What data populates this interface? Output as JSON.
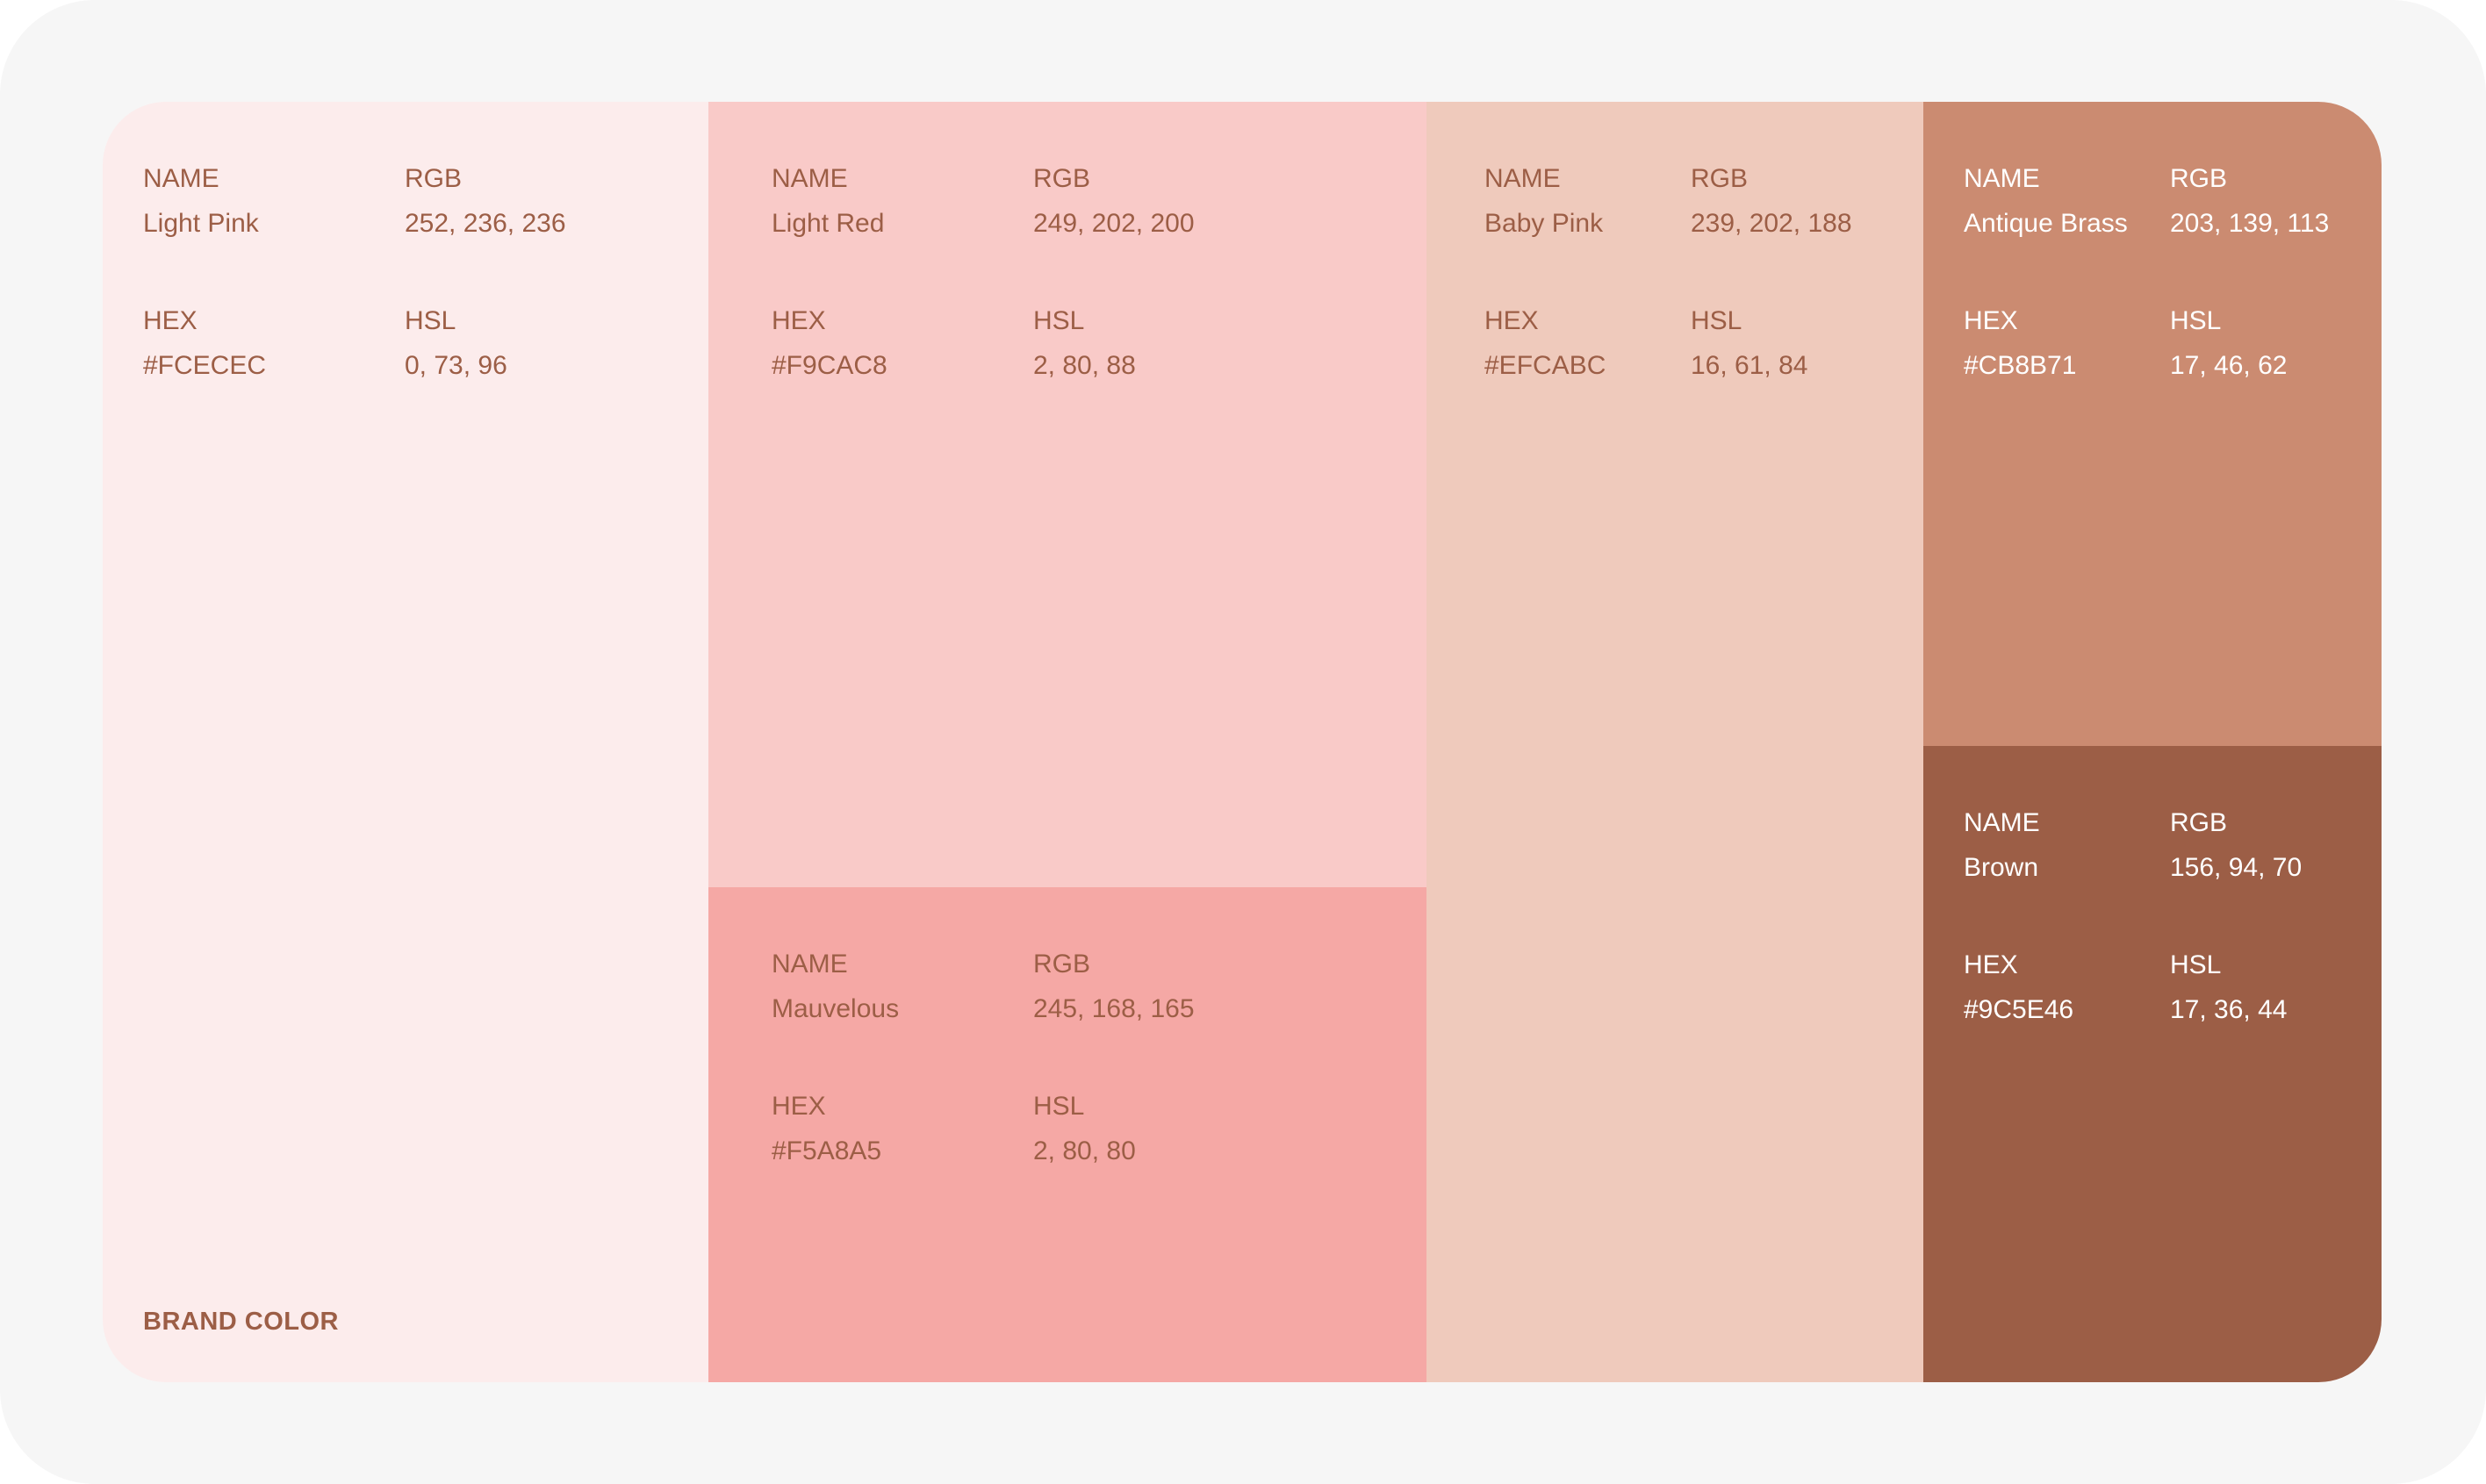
{
  "brand_label": "BRAND COLOR",
  "label_text_color": "#9C5E46",
  "swatches": [
    {
      "name": "Light Pink",
      "rgb": "252, 236, 236",
      "hex": "#FCECEC",
      "hsl": "0, 73, 96",
      "fill": "#FCECEC",
      "text_color": "#9C5E46",
      "labels": {
        "name": "NAME",
        "rgb": "RGB",
        "hex": "HEX",
        "hsl": "HSL"
      }
    },
    {
      "name": "Light Red",
      "rgb": "249, 202, 200",
      "hex": "#F9CAC8",
      "hsl": "2, 80, 88",
      "fill": "#F9CAC8",
      "text_color": "#9C5E46",
      "labels": {
        "name": "NAME",
        "rgb": "RGB",
        "hex": "HEX",
        "hsl": "HSL"
      }
    },
    {
      "name": "Mauvelous",
      "rgb": "245, 168, 165",
      "hex": "#F5A8A5",
      "hsl": "2, 80, 80",
      "fill": "#F5A8A5",
      "text_color": "#9C5E46",
      "labels": {
        "name": "NAME",
        "rgb": "RGB",
        "hex": "HEX",
        "hsl": "HSL"
      }
    },
    {
      "name": "Baby Pink",
      "rgb": "239, 202, 188",
      "hex": "#EFCABC",
      "hsl": "16, 61, 84",
      "fill": "#EFCABC",
      "text_color": "#9C5E46",
      "labels": {
        "name": "NAME",
        "rgb": "RGB",
        "hex": "HEX",
        "hsl": "HSL"
      }
    },
    {
      "name": "Antique Brass",
      "rgb": "203, 139, 113",
      "hex": "#CB8B71",
      "hsl": "17, 46, 62",
      "fill": "#CB8B71",
      "text_color": "#FFFFFF",
      "labels": {
        "name": "NAME",
        "rgb": "RGB",
        "hex": "HEX",
        "hsl": "HSL"
      }
    },
    {
      "name": "Brown",
      "rgb": "156, 94, 70",
      "hex": "#9C5E46",
      "hsl": "17, 36, 44",
      "fill": "#9C5E46",
      "text_color": "#FFFFFF",
      "labels": {
        "name": "NAME",
        "rgb": "RGB",
        "hex": "HEX",
        "hsl": "HSL"
      }
    }
  ]
}
